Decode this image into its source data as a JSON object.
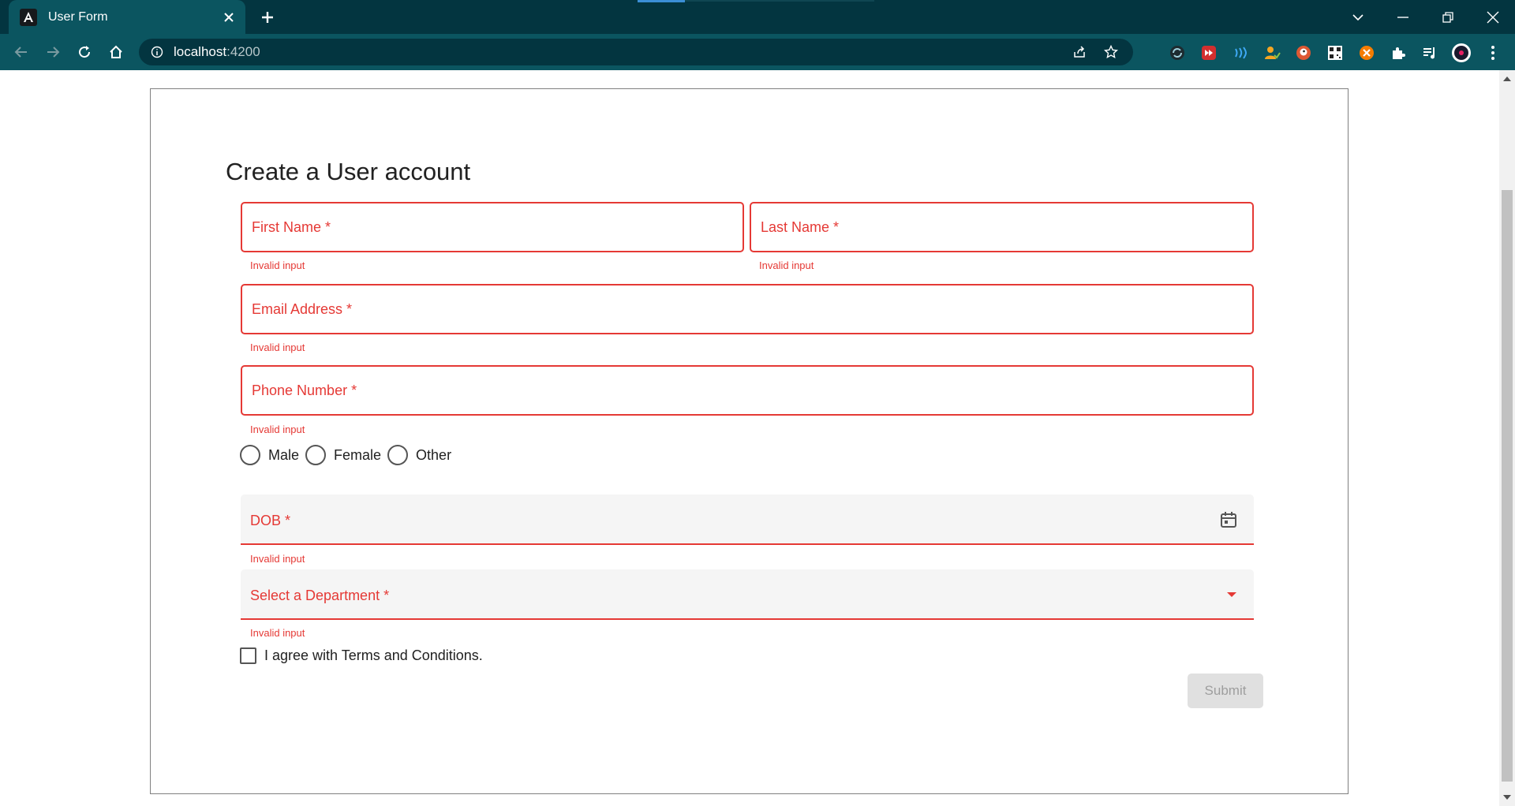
{
  "browser": {
    "tab_title": "User Form",
    "favicon_letter": "A",
    "url_host": "localhost",
    "url_port": ":4200",
    "tab_close_icon": "close-icon",
    "new_tab_icon": "plus-icon"
  },
  "form": {
    "title": "Create a User account",
    "first_name_label": "First Name *",
    "last_name_label": "Last Name *",
    "email_label": "Email Address *",
    "phone_label": "Phone Number *",
    "error_text": "Invalid input",
    "gender_options": [
      "Male",
      "Female",
      "Other"
    ],
    "dob_label": "DOB *",
    "department_label": "Select a Department *",
    "terms_label": "I agree with Terms and Conditions.",
    "submit_label": "Submit"
  },
  "colors": {
    "error": "#e53935",
    "chrome_dark": "#033540",
    "chrome_tab": "#0b5560"
  }
}
